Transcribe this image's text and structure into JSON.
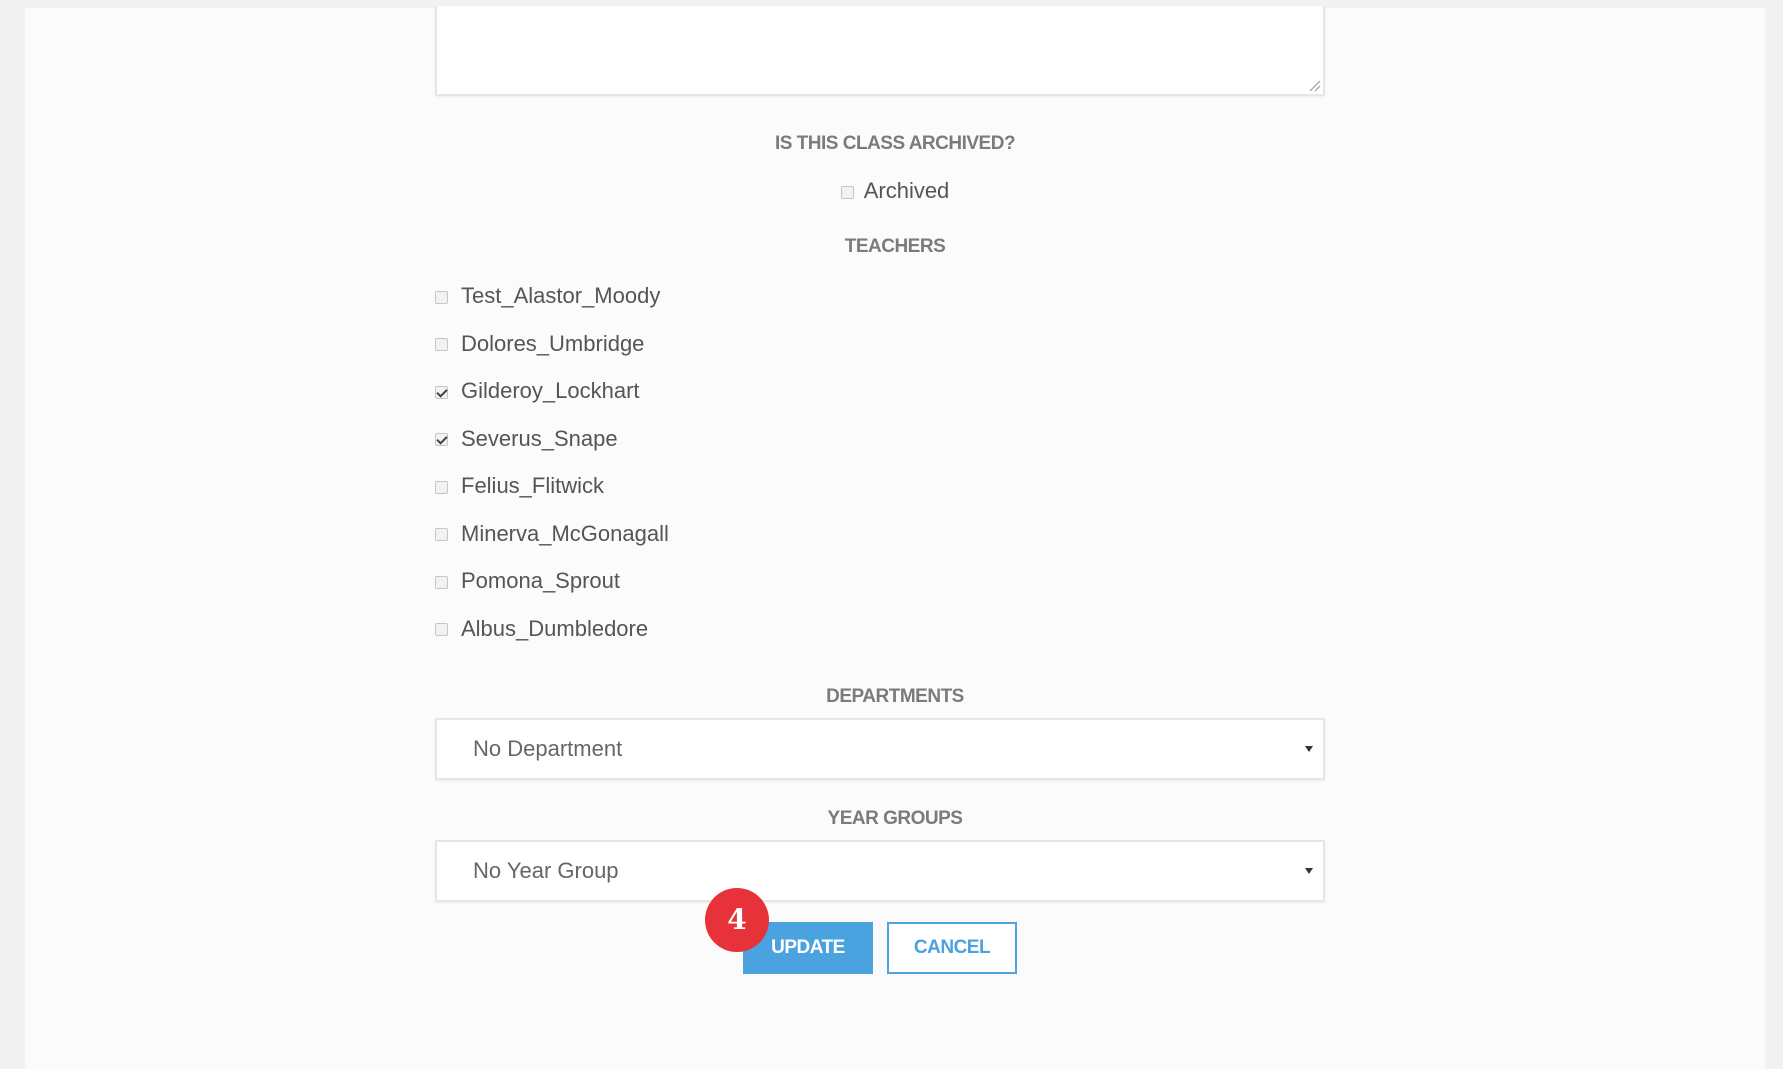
{
  "form": {
    "archived_section": {
      "label": "IS THIS CLASS ARCHIVED?",
      "checkbox_label": "Archived",
      "checked": false
    },
    "teachers_section": {
      "label": "TEACHERS",
      "teachers": [
        {
          "name": "Test_Alastor_Moody",
          "checked": false
        },
        {
          "name": "Dolores_Umbridge",
          "checked": false
        },
        {
          "name": "Gilderoy_Lockhart",
          "checked": true
        },
        {
          "name": "Severus_Snape",
          "checked": true
        },
        {
          "name": "Felius_Flitwick",
          "checked": false
        },
        {
          "name": "Minerva_McGonagall",
          "checked": false
        },
        {
          "name": "Pomona_Sprout",
          "checked": false
        },
        {
          "name": "Albus_Dumbledore",
          "checked": false
        }
      ]
    },
    "departments_section": {
      "label": "DEPARTMENTS",
      "selected": "No Department"
    },
    "year_groups_section": {
      "label": "YEAR GROUPS",
      "selected": "No Year Group"
    },
    "buttons": {
      "update_label": "UPDATE",
      "cancel_label": "CANCEL"
    }
  },
  "annotation": {
    "step_badge": "4",
    "badge_color": "#e8323a"
  },
  "colors": {
    "accent": "#4aa3df",
    "panel_bg": "#fbfbfb",
    "page_bg": "#f1f1f1",
    "label_text": "#7b7b7b"
  }
}
